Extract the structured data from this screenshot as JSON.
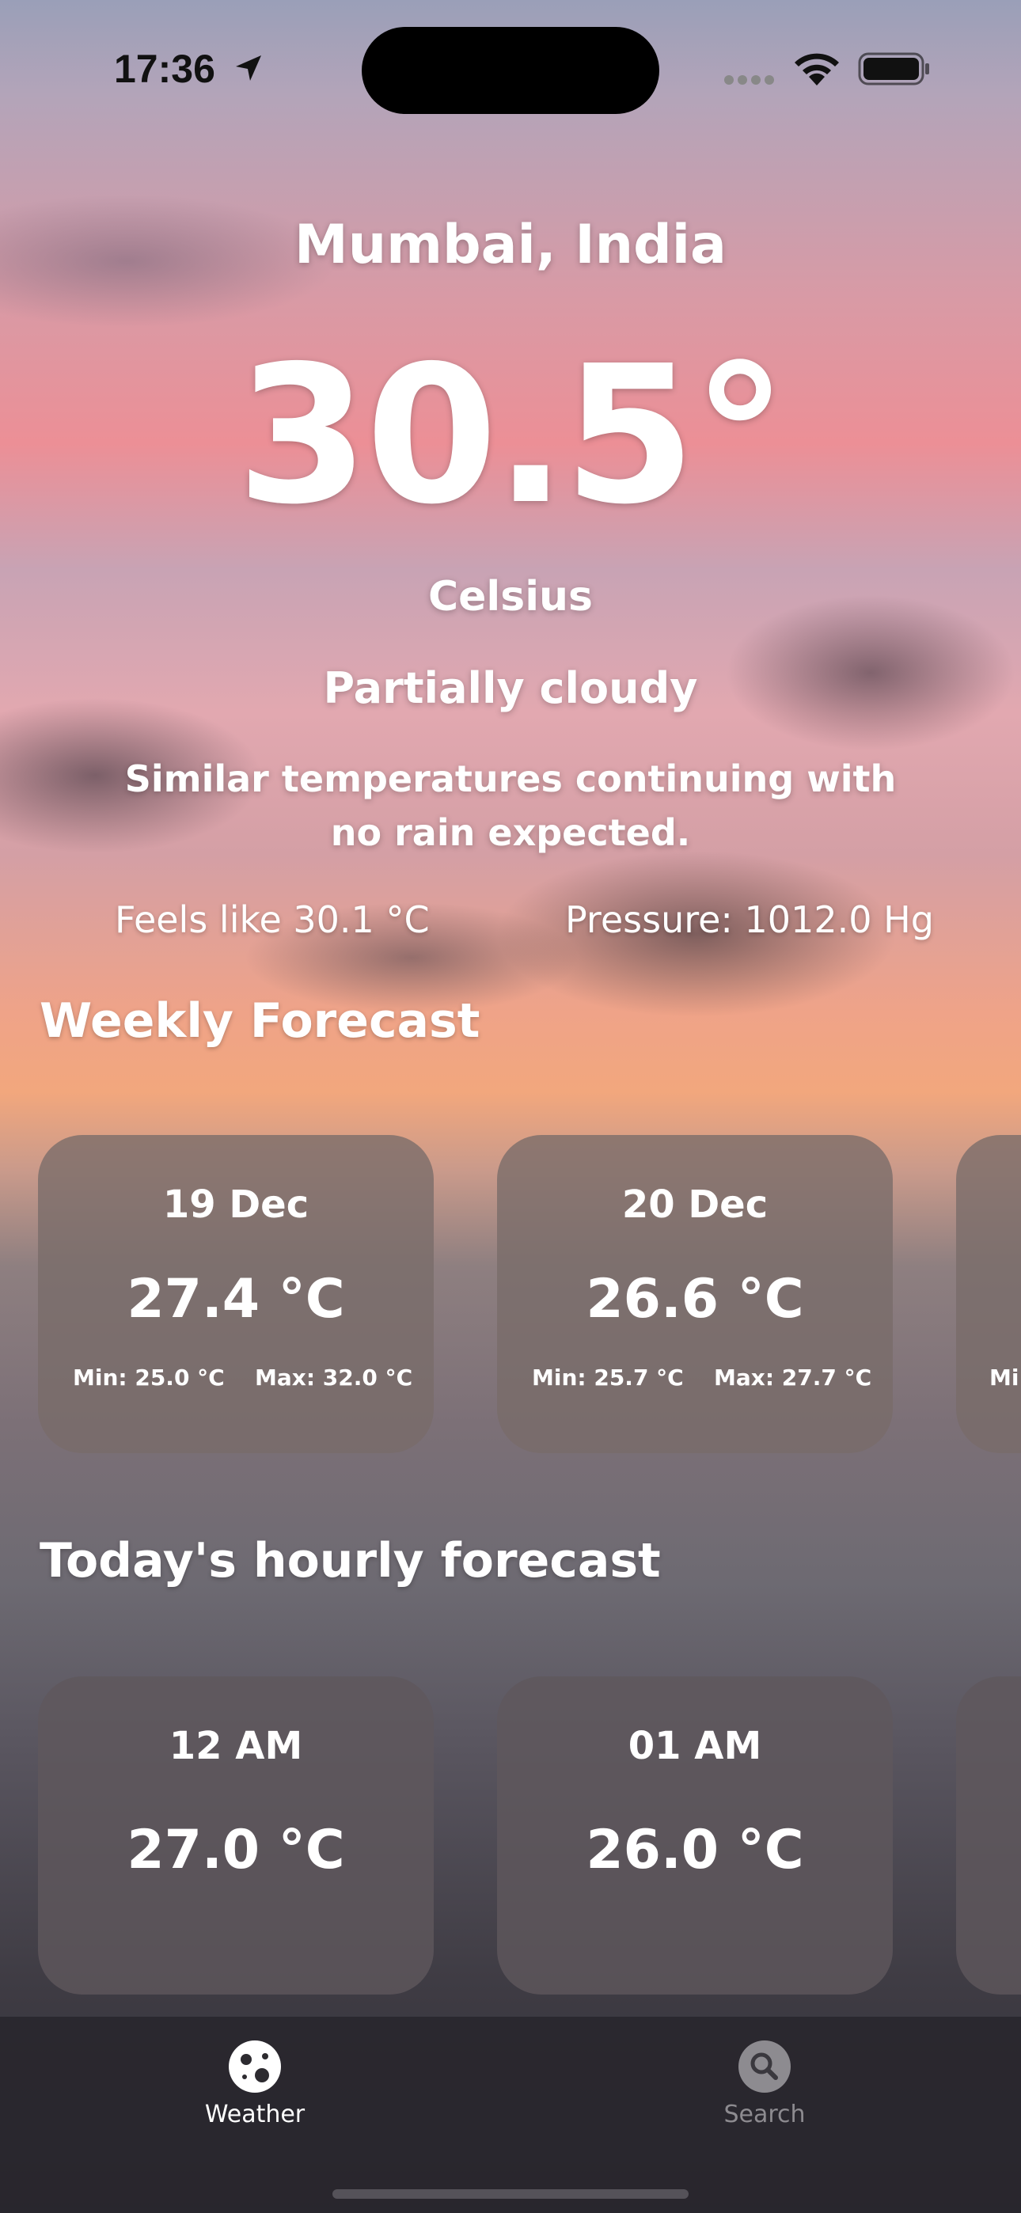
{
  "status": {
    "time": "17:36"
  },
  "current": {
    "city": "Mumbai, India",
    "temperature": "30.5°",
    "unit": "Celsius",
    "condition": "Partially cloudy",
    "description": "Similar temperatures continuing with no rain expected.",
    "feels_like": "Feels like 30.1 °C",
    "pressure": "Pressure: 1012.0 Hg"
  },
  "weekly": {
    "title": "Weekly Forecast",
    "cards": [
      {
        "date": "19 Dec",
        "temp": "27.4 °C",
        "min": "Min:  25.0 °C",
        "max": "Max:  32.0 °C"
      },
      {
        "date": "20 Dec",
        "temp": "26.6 °C",
        "min": "Min:  25.7 °C",
        "max": "Max:  27.7 °C"
      },
      {
        "min_partial": "Mi"
      }
    ]
  },
  "hourly": {
    "title": "Today's hourly forecast",
    "cards": [
      {
        "time": "12 AM",
        "temp": "27.0 °C"
      },
      {
        "time": "01 AM",
        "temp": "26.0 °C"
      }
    ]
  },
  "tabs": [
    {
      "label": "Weather",
      "icon": "globe-icon",
      "active": true
    },
    {
      "label": "Search",
      "icon": "search-icon",
      "active": false
    }
  ]
}
